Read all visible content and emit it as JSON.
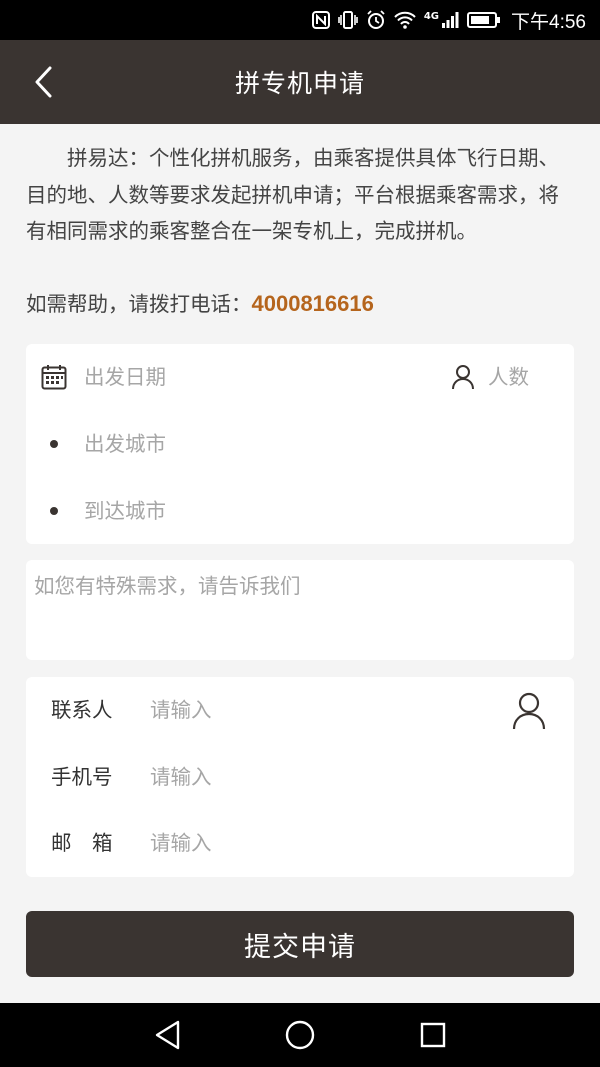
{
  "status_bar": {
    "time": "下午4:56",
    "network": "4G",
    "icons": [
      "nfc-icon",
      "vibrate-icon",
      "alarm-icon",
      "wifi-icon",
      "signal-icon",
      "battery-icon"
    ]
  },
  "header": {
    "title": "拼专机申请",
    "back_icon": "chevron-left-icon"
  },
  "intro": {
    "text": "拼易达：个性化拼机服务，由乘客提供具体飞行日期、目的地、人数等要求发起拼机申请；平台根据乘客需求，将有相同需求的乘客整合在一架专机上，完成拼机。",
    "help_prefix": "如需帮助，请拨打电话：",
    "help_phone": "4000816616"
  },
  "trip": {
    "date_placeholder": "出发日期",
    "people_placeholder": "人数",
    "from_placeholder": "出发城市",
    "to_placeholder": "到达城市"
  },
  "note": {
    "placeholder": "如您有特殊需求，请告诉我们"
  },
  "contact": {
    "name_label": "联系人",
    "phone_label": "手机号",
    "email_label": "邮　箱",
    "input_placeholder": "请输入"
  },
  "submit_label": "提交申请",
  "colors": {
    "header_bg": "#3a3431",
    "accent_phone": "#b5651d",
    "page_bg": "#f4f4f4",
    "placeholder": "#a6a6a6"
  }
}
